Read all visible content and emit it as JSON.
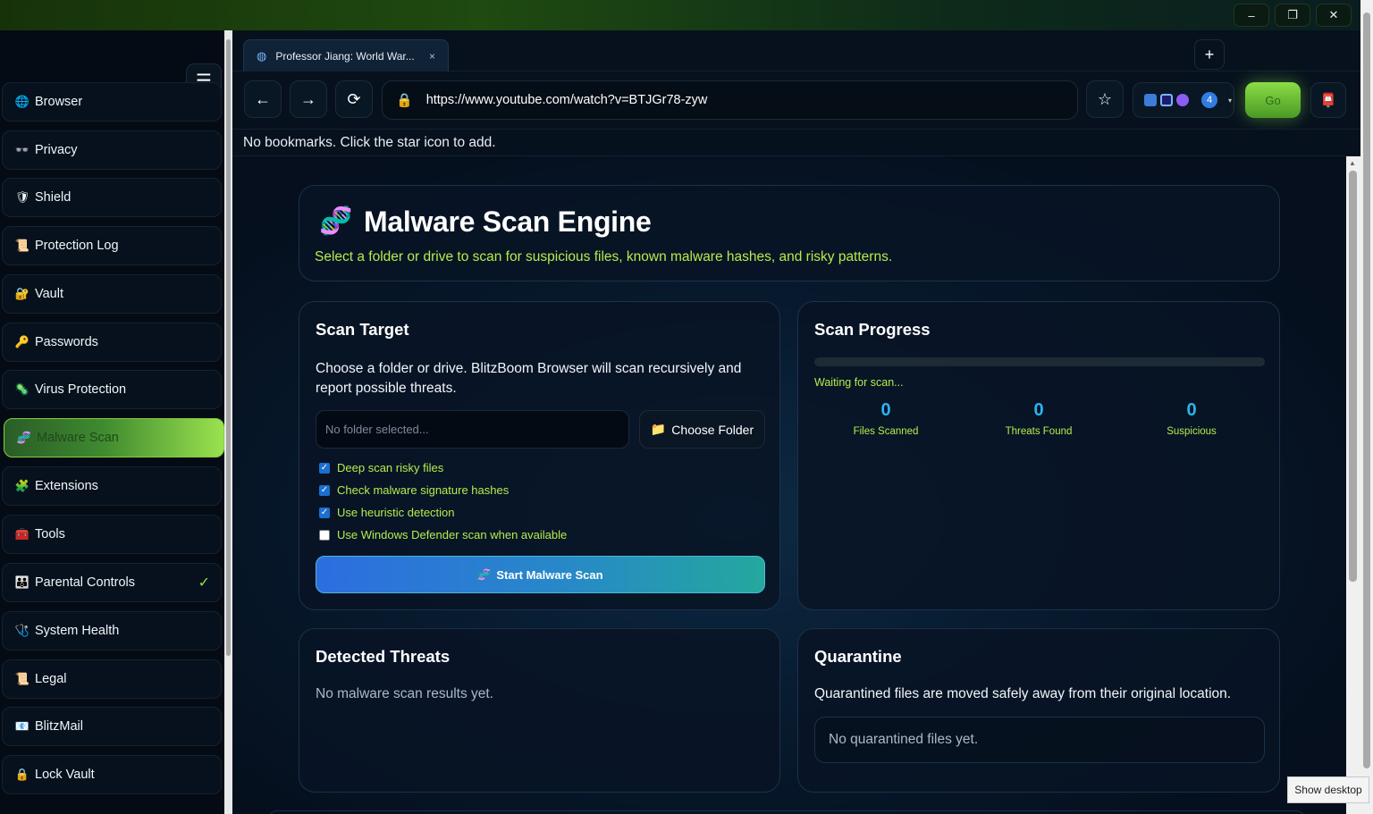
{
  "window": {
    "minimize_label": "–",
    "restore_label": "❐",
    "close_label": "✕"
  },
  "sidebar": {
    "menu_icon": "☰",
    "items": [
      {
        "icon": "🌐",
        "label": "Browser"
      },
      {
        "icon": "👓",
        "label": "Privacy"
      },
      {
        "icon": "🛡",
        "label": "Shield"
      },
      {
        "icon": "📜",
        "label": "Protection Log"
      },
      {
        "icon": "🔐",
        "label": "Vault"
      },
      {
        "icon": "🔑",
        "label": "Passwords"
      },
      {
        "icon": "🦠",
        "label": "Virus Protection"
      },
      {
        "icon": "🧬",
        "label": "Malware Scan"
      },
      {
        "icon": "🧩",
        "label": "Extensions"
      },
      {
        "icon": "🧰",
        "label": "Tools"
      },
      {
        "icon": "👪",
        "label": "Parental Controls"
      },
      {
        "icon": "🩺",
        "label": "System Health"
      },
      {
        "icon": "📜",
        "label": "Legal"
      },
      {
        "icon": "📧",
        "label": "BlitzMail"
      },
      {
        "icon": "🔒",
        "label": "Lock Vault"
      }
    ],
    "active_item": "Malware Scan",
    "parental_check": "✓"
  },
  "tabs": [
    {
      "title": "Professor Jiang: World War...",
      "close": "×"
    }
  ],
  "toolbar": {
    "new_tab": "+",
    "back": "←",
    "forward": "→",
    "reload": "⟳",
    "url": "https://www.youtube.com/watch?v=BTJGr78-zyw",
    "star": "☆",
    "extensions_badge": "4",
    "go_label": "Go"
  },
  "bookmarks_bar": {
    "empty_text": "No bookmarks. Click the star icon to add."
  },
  "page": {
    "title": "Malware Scan Engine",
    "subtitle": "Select a folder or drive to scan for suspicious files, known malware hashes, and risky patterns.",
    "scan_target": {
      "heading": "Scan Target",
      "description": "Choose a folder or drive. BlitzBoom Browser will scan recursively and report possible threats.",
      "folder_placeholder": "No folder selected...",
      "choose_button": "Choose Folder",
      "options": [
        {
          "label": "Deep scan risky files",
          "checked": true
        },
        {
          "label": "Check malware signature hashes",
          "checked": true
        },
        {
          "label": "Use heuristic detection",
          "checked": true
        },
        {
          "label": "Use Windows Defender scan when available",
          "checked": false
        }
      ],
      "start_button": "Start Malware Scan"
    },
    "scan_progress": {
      "heading": "Scan Progress",
      "progress_fraction": 0,
      "status": "Waiting for scan...",
      "stats": [
        {
          "value": "0",
          "label": "Files Scanned"
        },
        {
          "value": "0",
          "label": "Threats Found"
        },
        {
          "value": "0",
          "label": "Suspicious"
        }
      ]
    },
    "detected_threats": {
      "heading": "Detected Threats",
      "empty_text": "No malware scan results yet."
    },
    "quarantine": {
      "heading": "Quarantine",
      "description": "Quarantined files are moved safely away from their original location.",
      "empty_text": "No quarantined files yet."
    }
  },
  "tooltip": "Show desktop",
  "colors": {
    "accent_green": "#b5ec4c",
    "stat_blue": "#2bb3f0",
    "active_gradient_end": "#9be24f"
  }
}
